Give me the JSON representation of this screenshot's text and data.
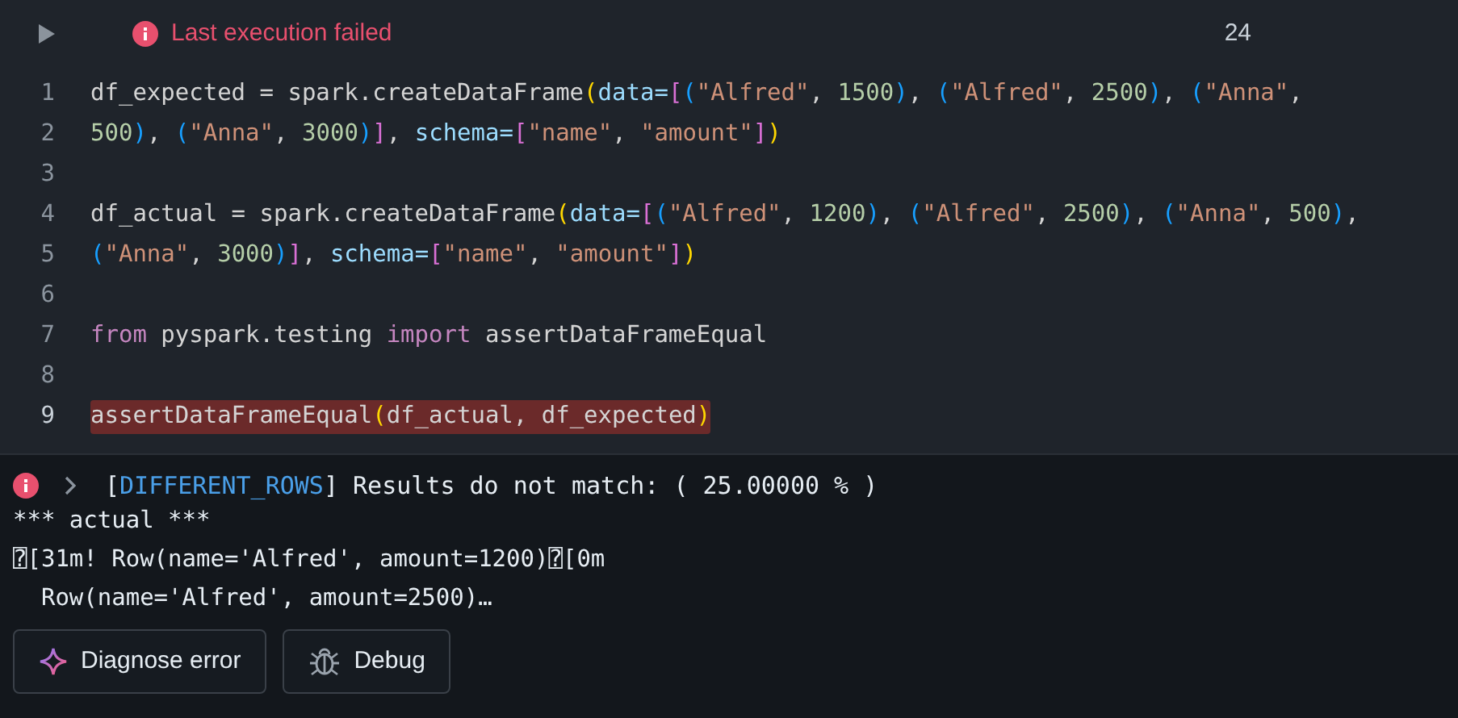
{
  "cell": {
    "status": {
      "text": "Last execution failed",
      "failed": true
    },
    "count": "24"
  },
  "code_lines": [
    {
      "number": "1",
      "highlighted": false,
      "tokens": [
        {
          "kind": "text",
          "text": "df_expected = spark.createDataFrame"
        },
        {
          "kind": "bracket1",
          "text": "("
        },
        {
          "kind": "param",
          "text": "data="
        },
        {
          "kind": "bracket2",
          "text": "["
        },
        {
          "kind": "bracket3",
          "text": "("
        },
        {
          "kind": "string",
          "text": "\"Alfred\""
        },
        {
          "kind": "text",
          "text": ", "
        },
        {
          "kind": "number",
          "text": "1500"
        },
        {
          "kind": "bracket3",
          "text": ")"
        },
        {
          "kind": "text",
          "text": ", "
        },
        {
          "kind": "bracket3",
          "text": "("
        },
        {
          "kind": "string",
          "text": "\"Alfred\""
        },
        {
          "kind": "text",
          "text": ", "
        },
        {
          "kind": "number",
          "text": "2500"
        },
        {
          "kind": "bracket3",
          "text": ")"
        },
        {
          "kind": "text",
          "text": ", "
        },
        {
          "kind": "bracket3",
          "text": "("
        },
        {
          "kind": "string",
          "text": "\"Anna\""
        },
        {
          "kind": "text",
          "text": ","
        }
      ]
    },
    {
      "number": "2",
      "highlighted": false,
      "tokens": [
        {
          "kind": "number",
          "text": "500"
        },
        {
          "kind": "bracket3",
          "text": ")"
        },
        {
          "kind": "text",
          "text": ", "
        },
        {
          "kind": "bracket3",
          "text": "("
        },
        {
          "kind": "string",
          "text": "\"Anna\""
        },
        {
          "kind": "text",
          "text": ", "
        },
        {
          "kind": "number",
          "text": "3000"
        },
        {
          "kind": "bracket3",
          "text": ")"
        },
        {
          "kind": "bracket2",
          "text": "]"
        },
        {
          "kind": "text",
          "text": ", "
        },
        {
          "kind": "param",
          "text": "schema="
        },
        {
          "kind": "bracket2",
          "text": "["
        },
        {
          "kind": "string",
          "text": "\"name\""
        },
        {
          "kind": "text",
          "text": ", "
        },
        {
          "kind": "string",
          "text": "\"amount\""
        },
        {
          "kind": "bracket2",
          "text": "]"
        },
        {
          "kind": "bracket1",
          "text": ")"
        }
      ]
    },
    {
      "number": "3",
      "highlighted": false
    },
    {
      "number": "4",
      "highlighted": false,
      "tokens": [
        {
          "kind": "text",
          "text": "df_actual = spark.createDataFrame"
        },
        {
          "kind": "bracket1",
          "text": "("
        },
        {
          "kind": "param",
          "text": "data="
        },
        {
          "kind": "bracket2",
          "text": "["
        },
        {
          "kind": "bracket3",
          "text": "("
        },
        {
          "kind": "string",
          "text": "\"Alfred\""
        },
        {
          "kind": "text",
          "text": ", "
        },
        {
          "kind": "number",
          "text": "1200"
        },
        {
          "kind": "bracket3",
          "text": ")"
        },
        {
          "kind": "text",
          "text": ", "
        },
        {
          "kind": "bracket3",
          "text": "("
        },
        {
          "kind": "string",
          "text": "\"Alfred\""
        },
        {
          "kind": "text",
          "text": ", "
        },
        {
          "kind": "number",
          "text": "2500"
        },
        {
          "kind": "bracket3",
          "text": ")"
        },
        {
          "kind": "text",
          "text": ", "
        },
        {
          "kind": "bracket3",
          "text": "("
        },
        {
          "kind": "string",
          "text": "\"Anna\""
        },
        {
          "kind": "text",
          "text": ", "
        },
        {
          "kind": "number",
          "text": "500"
        },
        {
          "kind": "bracket3",
          "text": ")"
        },
        {
          "kind": "text",
          "text": ","
        }
      ]
    },
    {
      "number": "5",
      "highlighted": false,
      "tokens": [
        {
          "kind": "bracket3",
          "text": "("
        },
        {
          "kind": "string",
          "text": "\"Anna\""
        },
        {
          "kind": "text",
          "text": ", "
        },
        {
          "kind": "number",
          "text": "3000"
        },
        {
          "kind": "bracket3",
          "text": ")"
        },
        {
          "kind": "bracket2",
          "text": "]"
        },
        {
          "kind": "text",
          "text": ", "
        },
        {
          "kind": "param",
          "text": "schema="
        },
        {
          "kind": "bracket2",
          "text": "["
        },
        {
          "kind": "string",
          "text": "\"name\""
        },
        {
          "kind": "text",
          "text": ", "
        },
        {
          "kind": "string",
          "text": "\"amount\""
        },
        {
          "kind": "bracket2",
          "text": "]"
        },
        {
          "kind": "bracket1",
          "text": ")"
        }
      ]
    },
    {
      "number": "6",
      "highlighted": false
    },
    {
      "number": "7",
      "highlighted": false,
      "tokens": [
        {
          "kind": "keyword",
          "text": "from"
        },
        {
          "kind": "text",
          "text": " pyspark.testing "
        },
        {
          "kind": "keyword",
          "text": "import"
        },
        {
          "kind": "text",
          "text": " assertDataFrameEqual"
        }
      ]
    },
    {
      "number": "8",
      "highlighted": false
    },
    {
      "number": "9",
      "highlighted": true,
      "tokens": [
        {
          "kind": "text",
          "text": "assertDataFrameEqual"
        },
        {
          "kind": "bracket1",
          "text": "("
        },
        {
          "kind": "text",
          "text": "df_actual, df_expected"
        },
        {
          "kind": "bracket1",
          "text": ")"
        }
      ]
    }
  ],
  "output": {
    "header": {
      "open_bracket": "[",
      "error_class": "DIFFERENT_ROWS",
      "message": "] Results do not match: ( 25.00000 % )",
      "expanded": false
    },
    "lines": [
      "*** actual ***",
      "⍰[31m! Row(name='Alfred', amount=1200)⍰[0m",
      "  Row(name='Alfred', amount=2500)…"
    ]
  },
  "buttons": [
    {
      "kind": "diagnose",
      "label": "Diagnose error"
    },
    {
      "kind": "debug",
      "label": "Debug"
    }
  ]
}
